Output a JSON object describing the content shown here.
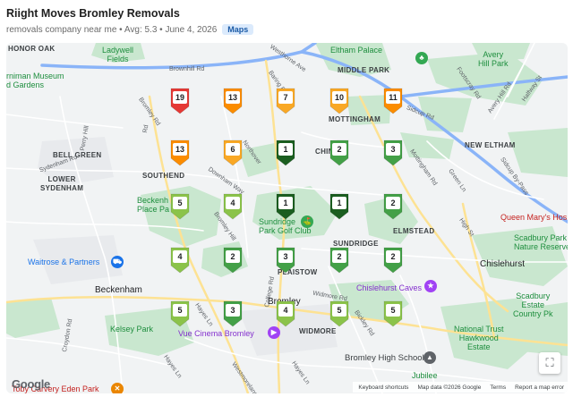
{
  "header": {
    "title": "Riight Moves Bromley Removals",
    "subtitle": "removals company near me • Avg: 5.3 • June 4, 2026",
    "badge": "Maps"
  },
  "map": {
    "labels": {
      "lewisham_museum": "rniman Museum\nd Gardens",
      "honor_oak": "HONOR OAK",
      "ladywell_fields": "Ladywell\nFields",
      "eltham_palace": "Eltham Palace",
      "middle_park": "MIDDLE PARK",
      "avery_hill_park": "Avery\nHill Park",
      "mottingham": "MOTTINGHAM",
      "bell_green": "BELL GREEN",
      "lower_sydenham": "LOWER\nSYDENHAM",
      "southend": "SOUTHEND",
      "new_eltham": "NEW ELTHAM",
      "beckenham_place_park": "Beckenh\nPlace Pa",
      "sundridge_park_golf_club": "Sundridge\nPark Golf Club",
      "chin": "CHIN",
      "elmstead": "ELMSTEAD",
      "queen_marys": "Queen Mary's Hos",
      "scadbury_nature_reserve": "Scadbury Park\nNature Reserve",
      "waitrose": "Waitrose & Partners",
      "chislehurst": "Chislehurst",
      "plaistow": "PLAISTOW",
      "sundridge": "SUNDRIDGE",
      "chislehurst_caves": "Chislehurst Caves",
      "beckenham": "Beckenham",
      "bromley": "Bromley",
      "scadbury_country_pk": "Scadbury\nEstate\nCountry Pk",
      "kelsey_park": "Kelsey Park",
      "widmore": "WIDMORE",
      "national_trust": "National Trust\nHawkwood\nEstate",
      "vue_cinema": "Vue Cinema Bromley",
      "bromley_high_school": "Bromley High School",
      "jubilee": "Jubilee",
      "toby_carvery": "Toby Carvery Eden Park",
      "brownhill_rd": "Brownhill Rd",
      "westhorne_ave": "Westhorne Ave",
      "sidcup_rd": "Sidcup Rd",
      "sidcup_bypass": "Sidcup By-Pass",
      "footscray_rd": "Footscray Rd",
      "avery_hill_rd": "Avery Hill Rd",
      "halfway_st": "Halfway St",
      "baring_rd": "Baring Rd",
      "perry_hill": "Perry Hill",
      "bromley_rd": "Bromley Rd",
      "sydenham_rd": "Sydenham Rd",
      "northover": "Northover",
      "downham_way": "Downham Way",
      "mottingham_rd": "Mottingham Rd",
      "green_ln": "Green Ln",
      "high_st": "High St",
      "bromley_hill": "Bromley Hill",
      "hayes_ln": "Hayes Ln",
      "rd_left": "Rd",
      "croydon_rd": "Croydon Rd",
      "widmore_rd": "Widmore Rd",
      "bickley_rd": "Bickley Rd",
      "college_rd": "College Rd",
      "westmoreland_rd": "Westmoreland Rd",
      "hayes_ln2": "Hayes Ln",
      "hayes_ln3": "Hayes Ln",
      "ridge_rd": "Lodge Rd",
      "lodge_ln": "Lodge Ln",
      "southborough": "Southborough Rd"
    },
    "markers": [
      {
        "rank": "19",
        "color": "#e53935"
      },
      {
        "rank": "13",
        "color": "#fb8c00"
      },
      {
        "rank": "7",
        "color": "#f9a825"
      },
      {
        "rank": "10",
        "color": "#f9a825"
      },
      {
        "rank": "11",
        "color": "#fb8c00"
      },
      {
        "rank": "13",
        "color": "#fb8c00"
      },
      {
        "rank": "6",
        "color": "#f9a825"
      },
      {
        "rank": "1",
        "color": "#1b5e20"
      },
      {
        "rank": "2",
        "color": "#43a047"
      },
      {
        "rank": "3",
        "color": "#43a047"
      },
      {
        "rank": "5",
        "color": "#8bc34a"
      },
      {
        "rank": "4",
        "color": "#8bc34a"
      },
      {
        "rank": "1",
        "color": "#1b5e20"
      },
      {
        "rank": "1",
        "color": "#1b5e20"
      },
      {
        "rank": "2",
        "color": "#43a047"
      },
      {
        "rank": "4",
        "color": "#8bc34a"
      },
      {
        "rank": "2",
        "color": "#43a047"
      },
      {
        "rank": "3",
        "color": "#43a047"
      },
      {
        "rank": "2",
        "color": "#43a047"
      },
      {
        "rank": "2",
        "color": "#43a047"
      },
      {
        "rank": "5",
        "color": "#8bc34a"
      },
      {
        "rank": "3",
        "color": "#43a047"
      },
      {
        "rank": "4",
        "color": "#8bc34a"
      },
      {
        "rank": "5",
        "color": "#8bc34a"
      },
      {
        "rank": "5",
        "color": "#8bc34a"
      }
    ],
    "google_logo": "Google",
    "footer": {
      "shortcuts": "Keyboard shortcuts",
      "map_data": "Map data ©2026 Google",
      "terms": "Terms",
      "report": "Report a map error"
    },
    "fullscreen_icon": "fullscreen-icon"
  }
}
